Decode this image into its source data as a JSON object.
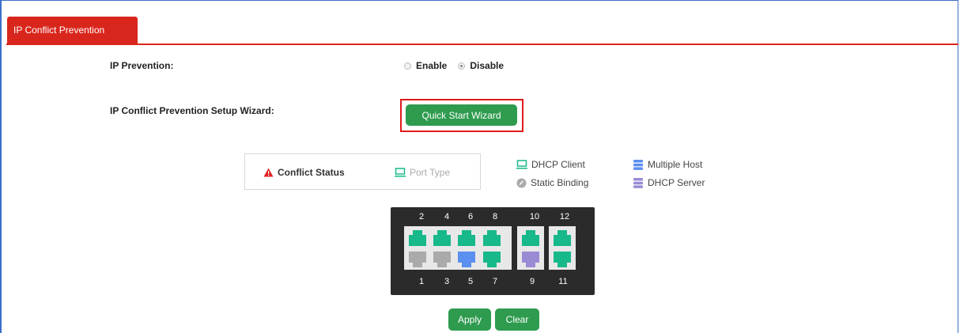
{
  "tab": {
    "label": "IP Conflict Prevention"
  },
  "ip_prevention": {
    "label": "IP Prevention:",
    "options": [
      {
        "label": "Enable",
        "checked": false
      },
      {
        "label": "Disable",
        "checked": true
      }
    ]
  },
  "wizard": {
    "label": "IP Conflict Prevention Setup Wizard:",
    "button": "Quick Start Wizard"
  },
  "legend": {
    "conflict_status": "Conflict Status",
    "port_type": "Port Type",
    "dhcp_client": "DHCP Client",
    "static_binding": "Static Binding",
    "multiple_host": "Multiple Host",
    "dhcp_server": "DHCP Server"
  },
  "colors": {
    "dhcp_client": "#17b88a",
    "multiple_host": "#5b8ff0",
    "dhcp_server": "#9b8bd4",
    "static_binding": "#aaaaaa",
    "conflict": "#e02424",
    "button_green": "#2e9b4f",
    "tab_red": "#d9261c"
  },
  "switch": {
    "top_numbers": [
      "2",
      "4",
      "6",
      "8",
      "10",
      "12"
    ],
    "bottom_numbers": [
      "1",
      "3",
      "5",
      "7",
      "9",
      "11"
    ],
    "ports": [
      {
        "number": "2",
        "type": "dhcp_client"
      },
      {
        "number": "4",
        "type": "dhcp_client"
      },
      {
        "number": "6",
        "type": "dhcp_client"
      },
      {
        "number": "8",
        "type": "dhcp_client"
      },
      {
        "number": "10",
        "type": "dhcp_client"
      },
      {
        "number": "12",
        "type": "dhcp_client"
      },
      {
        "number": "1",
        "type": "static_binding"
      },
      {
        "number": "3",
        "type": "static_binding"
      },
      {
        "number": "5",
        "type": "multiple_host"
      },
      {
        "number": "7",
        "type": "dhcp_client"
      },
      {
        "number": "9",
        "type": "dhcp_server"
      },
      {
        "number": "11",
        "type": "dhcp_client"
      }
    ]
  },
  "actions": {
    "apply": "Apply",
    "clear": "Clear"
  }
}
